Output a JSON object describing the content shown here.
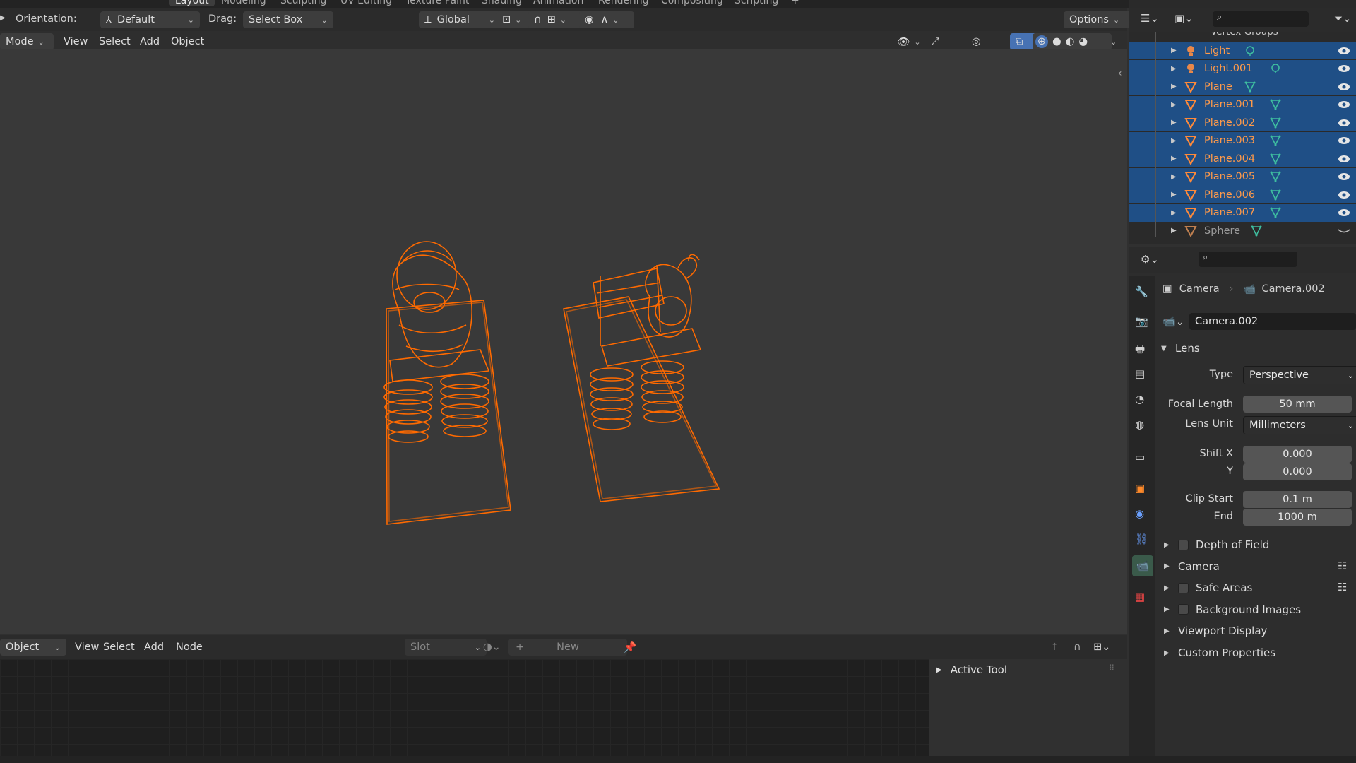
{
  "workspace_tabs": [
    "Layout",
    "Modeling",
    "Sculpting",
    "UV Editing",
    "Texture Paint",
    "Shading",
    "Animation",
    "Rendering",
    "Compositing",
    "Scripting"
  ],
  "tool_header": {
    "orientation_label": "Orientation:",
    "orientation_value": "Default",
    "drag_label": "Drag:",
    "drag_value": "Select Box",
    "transform_space": "Global",
    "options": "Options"
  },
  "viewport_header": {
    "mode": "Mode",
    "menus": [
      "View",
      "Select",
      "Add",
      "Object"
    ]
  },
  "outliner": {
    "top_item": "Vertex Groups",
    "rows": [
      {
        "label": "Light",
        "type": "light",
        "selected": true
      },
      {
        "label": "Light.001",
        "type": "light",
        "selected": true
      },
      {
        "label": "Plane",
        "type": "mesh",
        "selected": true
      },
      {
        "label": "Plane.001",
        "type": "mesh",
        "selected": true
      },
      {
        "label": "Plane.002",
        "type": "mesh",
        "selected": true
      },
      {
        "label": "Plane.003",
        "type": "mesh",
        "selected": true
      },
      {
        "label": "Plane.004",
        "type": "mesh",
        "selected": true
      },
      {
        "label": "Plane.005",
        "type": "mesh",
        "selected": true
      },
      {
        "label": "Plane.006",
        "type": "mesh",
        "selected": true
      },
      {
        "label": "Plane.007",
        "type": "mesh",
        "selected": true
      },
      {
        "label": "Sphere",
        "type": "mesh",
        "selected": false
      }
    ]
  },
  "properties": {
    "breadcrumb_object": "Camera",
    "breadcrumb_data": "Camera.002",
    "datablock_name": "Camera.002",
    "lens_panel": "Lens",
    "type_label": "Type",
    "type_value": "Perspective",
    "focal_length_label": "Focal Length",
    "focal_length_value": "50 mm",
    "lens_unit_label": "Lens Unit",
    "lens_unit_value": "Millimeters",
    "shift_x_label": "Shift X",
    "shift_x_value": "0.000",
    "shift_y_label": "Y",
    "shift_y_value": "0.000",
    "clip_start_label": "Clip Start",
    "clip_start_value": "0.1 m",
    "clip_end_label": "End",
    "clip_end_value": "1000 m",
    "subpanels": [
      {
        "label": "Depth of Field",
        "checkbox": true,
        "list_icon": false
      },
      {
        "label": "Camera",
        "checkbox": false,
        "list_icon": true
      },
      {
        "label": "Safe Areas",
        "checkbox": true,
        "list_icon": true
      },
      {
        "label": "Background Images",
        "checkbox": true,
        "list_icon": false
      },
      {
        "label": "Viewport Display",
        "checkbox": false,
        "list_icon": false
      },
      {
        "label": "Custom Properties",
        "checkbox": false,
        "list_icon": false
      }
    ]
  },
  "node_editor": {
    "mode": "Object",
    "menus": [
      "View",
      "Select",
      "Add",
      "Node"
    ],
    "slot": "Slot",
    "new_button": "New",
    "sidebar_panel": "Active Tool"
  },
  "colors": {
    "accent_orange": "#ff6a00",
    "selection_blue": "#1f4f86",
    "mesh_data_green": "#3fbfa0"
  }
}
